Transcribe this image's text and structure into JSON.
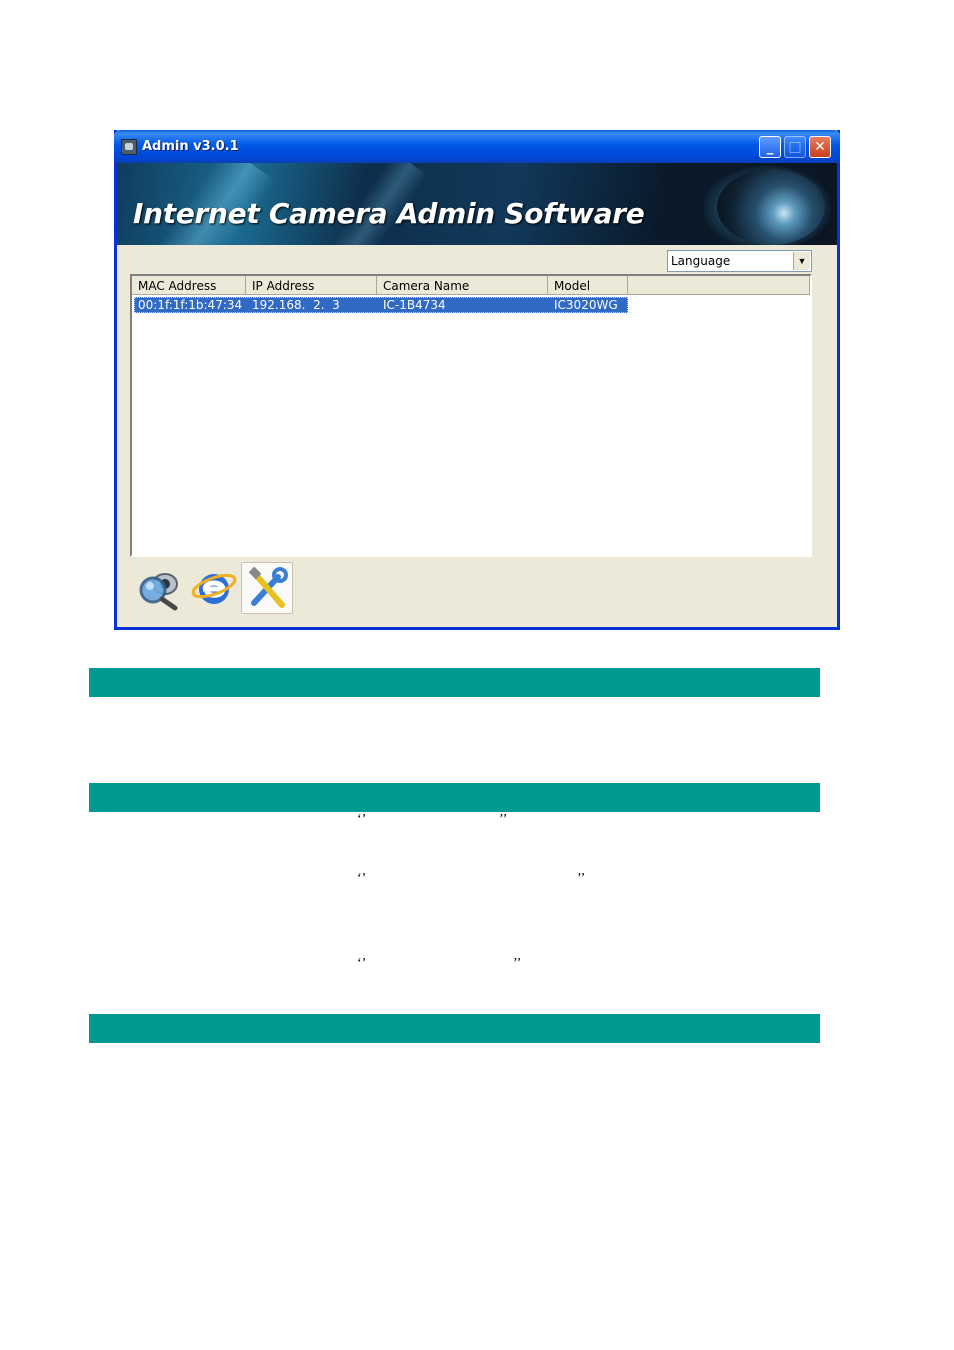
{
  "window": {
    "title": "Admin v3.0.1",
    "minimize_glyph": "_",
    "maximize_glyph": "□",
    "close_glyph": "✕",
    "banner_title": "Internet Camera Admin Software"
  },
  "language_select": {
    "selected": "Language",
    "arrow_glyph": "▼"
  },
  "device_list": {
    "columns": [
      "MAC Address",
      "IP Address",
      "Camera Name",
      "Model"
    ],
    "rows": [
      {
        "mac": "00:1f:1f:1b:47:34",
        "ip": "192.168.  2.  3",
        "name": "IC-1B4734",
        "model": "IC3020WG"
      }
    ],
    "selected_row": 0
  },
  "toolbar": {
    "icons": [
      "search-camera-icon",
      "internet-explorer-icon",
      "configure-tools-icon"
    ],
    "selected": "configure-tools-icon"
  },
  "document": {
    "quote_open": "‘’",
    "quote_close": "’’",
    "colors": {
      "teal_bar": "#009a93",
      "selection": "#316ac5"
    }
  }
}
